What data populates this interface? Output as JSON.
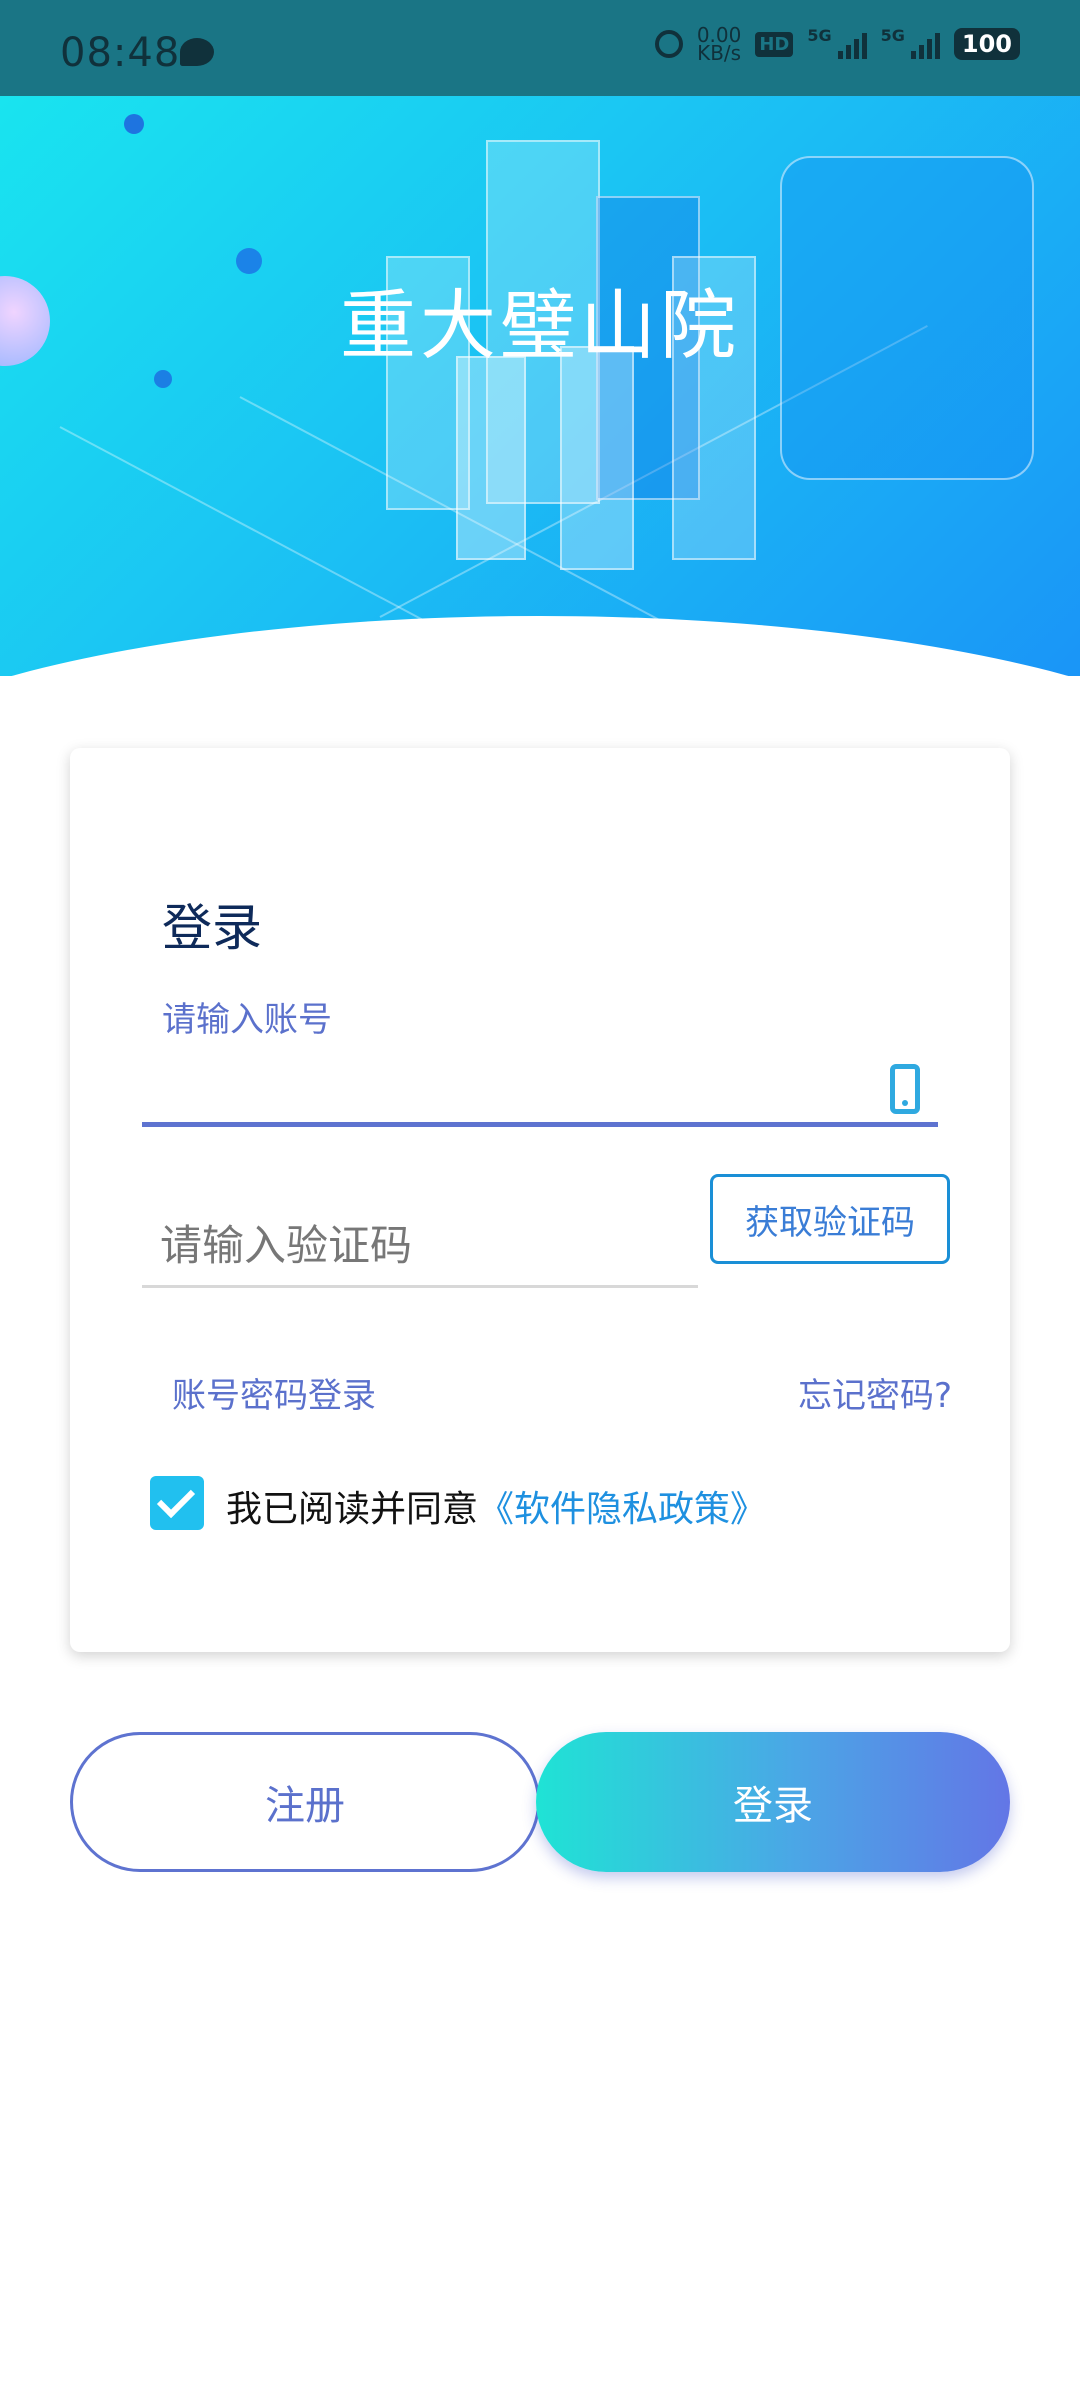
{
  "status_bar": {
    "time": "08:48",
    "speed_value": "0.00",
    "speed_unit": "KB/s",
    "hd_label": "HD",
    "network_1": "5G",
    "network_2": "5G",
    "battery": "100"
  },
  "hero": {
    "title": "重大璧山院"
  },
  "login_card": {
    "title": "登录",
    "account_label": "请输入账号",
    "code_placeholder": "请输入验证码",
    "get_code_label": "获取验证码",
    "password_login_label": "账号密码登录",
    "forgot_password_label": "忘记密码?",
    "agree_text": "我已阅读并同意",
    "policy_link": "《软件隐私政策》",
    "agree_checked": true
  },
  "actions": {
    "register_label": "注册",
    "login_label": "登录"
  },
  "colors": {
    "accent_blue": "#5e73d0",
    "link_blue": "#1e90e0",
    "checkbox": "#21c0ef",
    "status_bar_bg": "#1a7585"
  },
  "icons": {
    "message": "message-bubble-icon",
    "alarm": "alarm-icon",
    "phone": "phone-icon",
    "check": "check-icon"
  }
}
